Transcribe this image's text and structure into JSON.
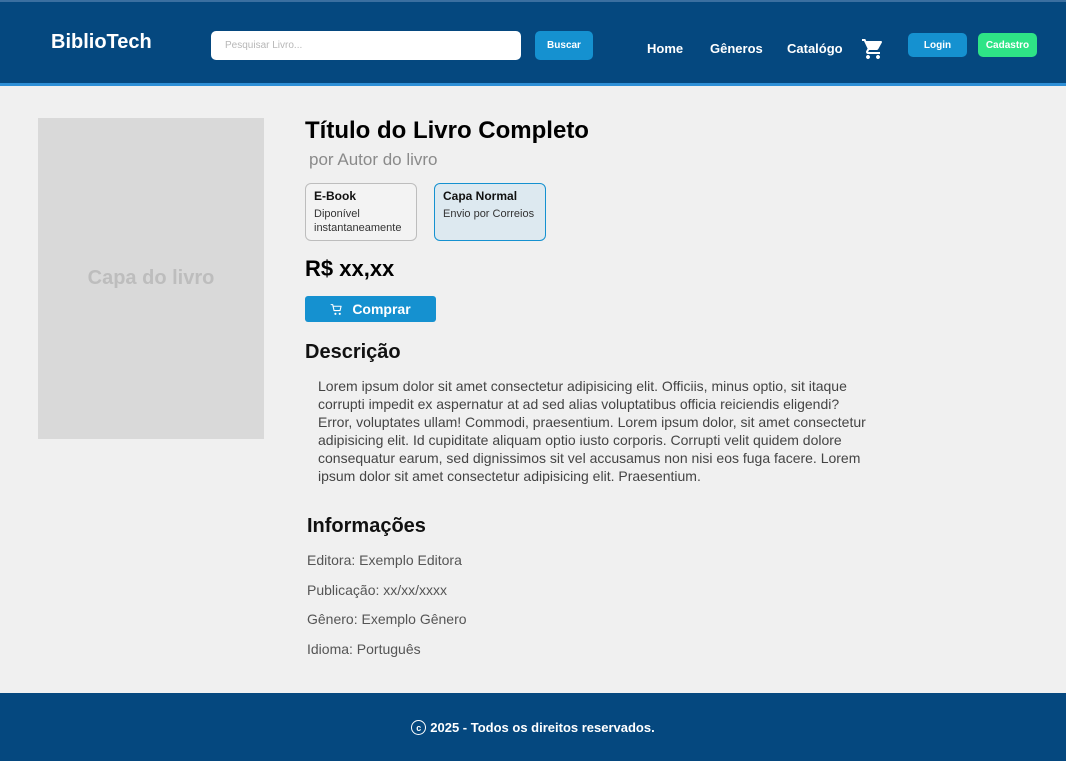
{
  "header": {
    "logo": "BiblioTech",
    "search": {
      "placeholder": "Pesquisar Livro...",
      "value": "",
      "button_label": "Buscar"
    },
    "nav": [
      {
        "label": "Home"
      },
      {
        "label": "Gêneros"
      },
      {
        "label": "Catalógo"
      }
    ],
    "cart_icon": "shopping-cart-icon",
    "login_label": "Login",
    "signup_label": "Cadastro"
  },
  "cover": {
    "label": "Capa do livro"
  },
  "book": {
    "title": "Título do Livro Completo",
    "author": "por Autor do livro",
    "formats": [
      {
        "name": "E-Book",
        "description": "Diponível instantaneamente",
        "selected": false
      },
      {
        "name": "Capa Normal",
        "description": "Envio por Correios",
        "selected": true
      }
    ],
    "price": "R$ xx,xx",
    "buy_label": "Comprar",
    "buy_icon": "cart-icon"
  },
  "description": {
    "title": "Descrição",
    "text": "Lorem ipsum dolor sit amet consectetur adipisicing elit. Officiis, minus optio, sit itaque corrupti impedit ex aspernatur at ad sed alias voluptatibus officia reiciendis eligendi? Error, voluptates ullam! Commodi, praesentium. Lorem ipsum dolor, sit amet consectetur adipisicing elit. Id cupiditate aliquam optio iusto corporis. Corrupti velit quidem dolore consequatur earum, sed dignissimos sit vel accusamus non nisi eos fuga facere. Lorem ipsum dolor sit amet consectetur adipisicing elit. Praesentium."
  },
  "info": {
    "title": "Informações",
    "lines": [
      "Editora: Exemplo Editora",
      "Publicação: xx/xx/xxxx",
      "Gênero: Exemplo Gênero",
      "Idioma: Português"
    ]
  },
  "footer": {
    "copyright_symbol": "c",
    "text": "2025 - Todos os direitos reservados."
  },
  "colors": {
    "header_bg": "#05487f",
    "accent_blue": "#1591d0",
    "signup_green": "#2ee486",
    "page_bg": "#f0f0f0"
  }
}
